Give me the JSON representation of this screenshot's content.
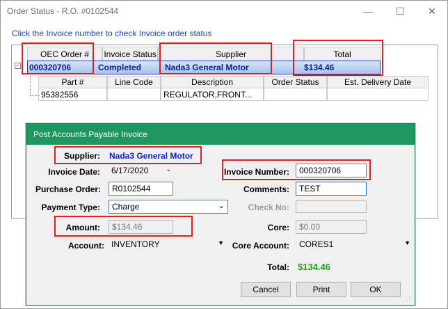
{
  "window": {
    "title": "Order Status - R.O. #0102544",
    "controls": {
      "minimize": "—",
      "maximize": "☐",
      "close": "✕"
    }
  },
  "hint_text": "Click the Invoice number to check Invoice order status",
  "grid": {
    "headers": [
      "OEC Order #",
      "Invoice Status",
      "Supplier",
      "Total"
    ],
    "row": {
      "order_number": "000320706",
      "invoice_status": "Completed",
      "supplier": "Nada3 General Motor",
      "total": "$134.46"
    },
    "expander": "−",
    "sub_headers": [
      "Part #",
      "Line Code",
      "Description",
      "Order Status",
      "Est. Delivery Date"
    ],
    "sub_row": [
      "95382556",
      "",
      "REGULATOR,FRONT...",
      "",
      ""
    ]
  },
  "dialog": {
    "title": "Post Accounts Payable Invoice",
    "supplier_label": "Supplier:",
    "supplier_value": "Nada3  General Motor",
    "invoice_date_label": "Invoice Date:",
    "invoice_date_value": "6/17/2020",
    "invoice_number_label": "Invoice Number:",
    "invoice_number_value": "000320706",
    "purchase_order_label": "Purchase Order:",
    "purchase_order_value": "R0102544",
    "comments_label": "Comments:",
    "comments_value": "TEST",
    "payment_type_label": "Payment Type:",
    "payment_type_value": "Charge",
    "check_no_label": "Check No:",
    "check_no_value": "",
    "amount_label": "Amount:",
    "amount_value": "$134.46",
    "core_label": "Core:",
    "core_value": "$0.00",
    "account_label": "Account:",
    "account_value": "INVENTORY",
    "core_account_label": "Core Account:",
    "core_account_value": "CORES1",
    "total_label": "Total:",
    "total_value": "$134.46",
    "buttons": {
      "cancel": "Cancel",
      "print": "Print",
      "ok": "OK"
    }
  },
  "colors": {
    "dialog_title_bg": "#1f9660",
    "highlight_red": "#e02020",
    "total_green": "#18a21a",
    "supplier_blue": "#0a1fd0"
  }
}
